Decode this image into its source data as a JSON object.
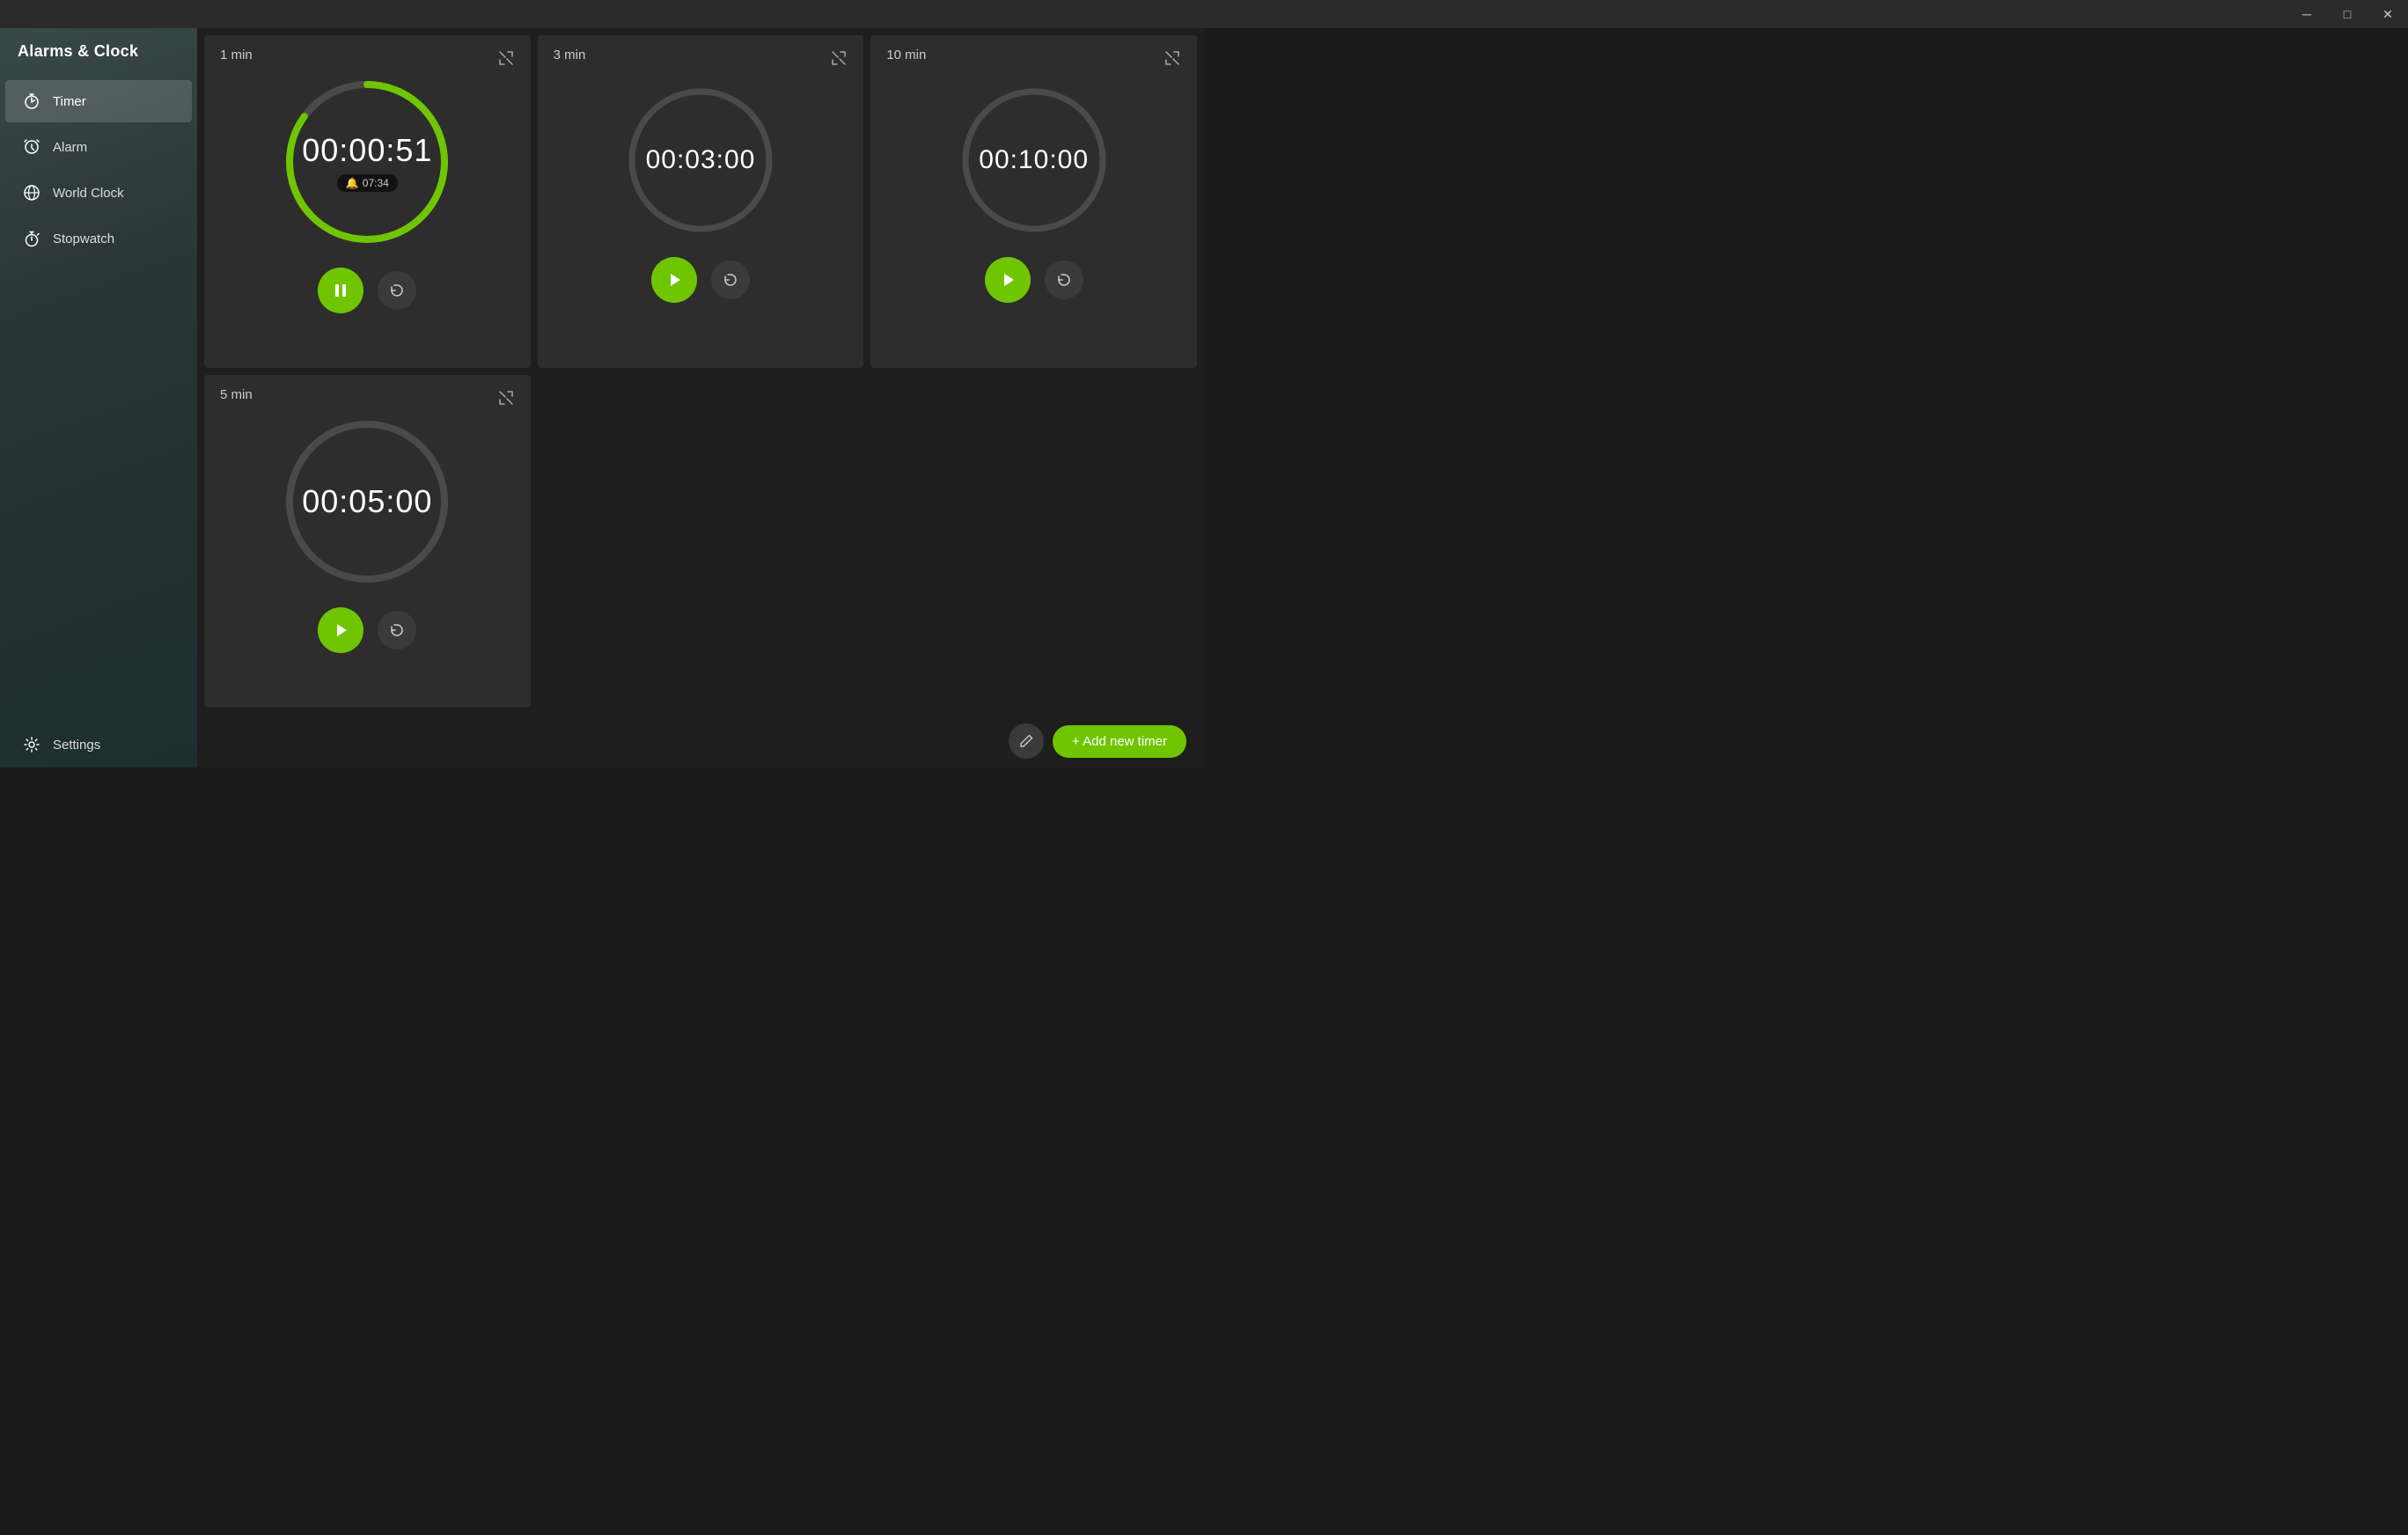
{
  "app": {
    "title": "Alarms & Clock"
  },
  "titlebar": {
    "minimize": "─",
    "maximize": "□",
    "close": "✕"
  },
  "sidebar": {
    "items": [
      {
        "id": "timer",
        "label": "Timer",
        "icon": "⏱",
        "active": true
      },
      {
        "id": "alarm",
        "label": "Alarm",
        "icon": "🔔",
        "active": false
      },
      {
        "id": "worldclock",
        "label": "World Clock",
        "icon": "🌐",
        "active": false
      },
      {
        "id": "stopwatch",
        "label": "Stopwatch",
        "icon": "⏱",
        "active": false
      }
    ],
    "settings": {
      "label": "Settings",
      "icon": "⚙"
    }
  },
  "timers": [
    {
      "id": "t1",
      "label": "1 min",
      "time": "00:00:51",
      "alarm": "07:34",
      "state": "running",
      "progress": 0.85,
      "circumference": 565,
      "dashoffset": 85
    },
    {
      "id": "t2",
      "label": "3 min",
      "time": "00:03:00",
      "state": "paused",
      "progress": 0,
      "circumference": 503,
      "dashoffset": 503
    },
    {
      "id": "t3",
      "label": "10 min",
      "time": "00:10:00",
      "state": "paused",
      "progress": 0,
      "circumference": 503,
      "dashoffset": 503
    },
    {
      "id": "t4",
      "label": "5 min",
      "time": "00:05:00",
      "state": "paused",
      "progress": 0,
      "circumference": 503,
      "dashoffset": 503
    }
  ],
  "bottomBar": {
    "addTimerLabel": "+ Add new timer",
    "editIcon": "✏"
  }
}
